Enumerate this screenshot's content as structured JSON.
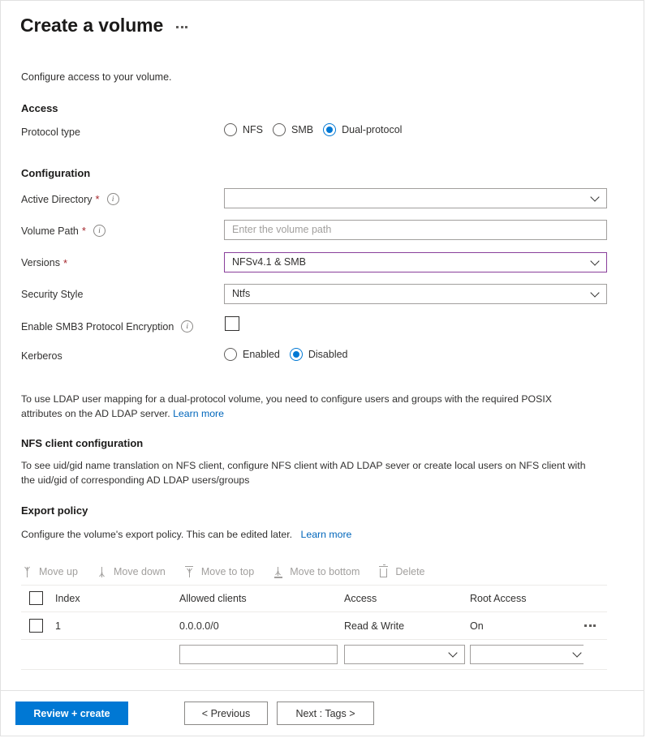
{
  "header": {
    "title": "Create a volume",
    "more_menu": "more-options"
  },
  "intro": "Configure access to your volume.",
  "access": {
    "section_title": "Access",
    "protocol_label": "Protocol type",
    "protocol_options": [
      "NFS",
      "SMB",
      "Dual-protocol"
    ],
    "protocol_selected": "Dual-protocol"
  },
  "configuration": {
    "section_title": "Configuration",
    "active_directory": {
      "label": "Active Directory",
      "required": "*",
      "value": "",
      "placeholder": ""
    },
    "volume_path": {
      "label": "Volume Path",
      "required": "*",
      "value": "",
      "placeholder": "Enter the volume path"
    },
    "versions": {
      "label": "Versions",
      "required": "*",
      "value": "NFSv4.1 & SMB",
      "border_color": "#893f9b"
    },
    "security_style": {
      "label": "Security Style",
      "value": "Ntfs"
    },
    "smb3_encryption": {
      "label": "Enable SMB3 Protocol Encryption",
      "checked": false
    },
    "kerberos": {
      "label": "Kerberos",
      "options": [
        "Enabled",
        "Disabled"
      ],
      "selected": "Disabled"
    }
  },
  "ldap_note": {
    "text": "To use LDAP user mapping for a dual-protocol volume, you need to configure users and groups with the required POSIX attributes on the AD LDAP server.",
    "link": "Learn more"
  },
  "nfs_client": {
    "section_title": "NFS client configuration",
    "text": "To see uid/gid name translation on NFS client, configure NFS client with AD LDAP sever or create local users on NFS client with the uid/gid of corresponding AD LDAP users/groups"
  },
  "export_policy": {
    "section_title": "Export policy",
    "description": "Configure the volume's export policy. This can be edited later.",
    "link": "Learn more",
    "toolbar": [
      {
        "label": "Move up",
        "icon": "arrow-up-icon",
        "disabled": true
      },
      {
        "label": "Move down",
        "icon": "arrow-down-icon",
        "disabled": true
      },
      {
        "label": "Move to top",
        "icon": "arrow-to-top-icon",
        "disabled": true
      },
      {
        "label": "Move to bottom",
        "icon": "arrow-to-bottom-icon",
        "disabled": true
      },
      {
        "label": "Delete",
        "icon": "trash-icon",
        "disabled": true
      }
    ],
    "table": {
      "columns": [
        "Index",
        "Allowed clients",
        "Access",
        "Root Access"
      ],
      "rows": [
        {
          "index": "1",
          "allowed_clients": "0.0.0.0/0",
          "access": "Read & Write",
          "root_access": "On",
          "checked": false
        }
      ],
      "new_row": {
        "allowed_clients": "",
        "access": "",
        "root_access": ""
      }
    }
  },
  "footer": {
    "review_create": "Review + create",
    "previous": "< Previous",
    "next": "Next : Tags >",
    "primary_color": "#0078d4"
  }
}
